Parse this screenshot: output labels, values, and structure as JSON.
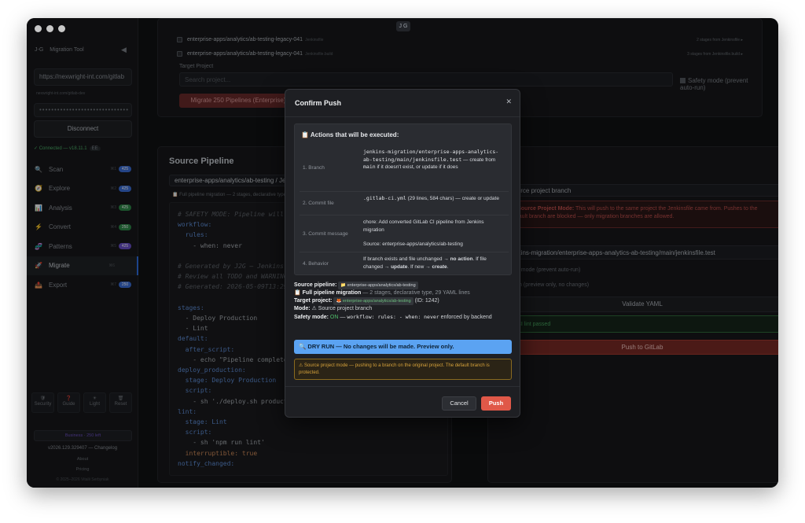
{
  "window": {
    "logo": "J G"
  },
  "sidebar": {
    "brand": "J-G",
    "title": "Migration Tool",
    "url": "https://nexwright-int.com/gitlab",
    "url_sub": "nexwright-int.com/gitlab-dev",
    "token": "••••••••••••••••••••••••••••••",
    "disconnect": "Disconnect",
    "status": "✓ Connected — v18.11.1",
    "status_pill": "EE",
    "items": [
      {
        "label": "Scan",
        "icon": "🔍",
        "kbd": "⌘1",
        "count": "425"
      },
      {
        "label": "Explore",
        "icon": "🧭",
        "kbd": "⌘2",
        "count": "425"
      },
      {
        "label": "Analysis",
        "icon": "📊",
        "kbd": "⌘3",
        "count": "425"
      },
      {
        "label": "Convert",
        "icon": "⚡",
        "kbd": "⌘4",
        "count": "250"
      },
      {
        "label": "Patterns",
        "icon": "🧬",
        "kbd": "⌘5",
        "count": "425"
      },
      {
        "label": "Migrate",
        "icon": "🚀",
        "kbd": "⌘6",
        "count": ""
      },
      {
        "label": "Export",
        "icon": "📤",
        "kbd": "⌘7",
        "count": "250"
      }
    ],
    "tools": [
      {
        "label": "Security",
        "icon": "🛡"
      },
      {
        "label": "Guide",
        "icon": "❓"
      },
      {
        "label": "Light",
        "icon": "☀"
      },
      {
        "label": "Reset",
        "icon": "🗑"
      }
    ],
    "tier": "Business · 250 left",
    "version": "v2026.129.329407 — Changelog",
    "about": "About",
    "pricing": "Pricing",
    "copyright": "© 2025–2026 Vitalii Serbyniak"
  },
  "pipelines": [
    {
      "name": "enterprise-apps/analytics/ab-testing-legacy-041",
      "tag": "Jenkinsfile",
      "right": "2 stages  from Jenkinsfile  ▸"
    },
    {
      "name": "enterprise-apps/analytics/ab-testing-legacy-041",
      "tag": "Jenkinsfile.build",
      "right": "3 stages  from Jenkinsfile.build  ▸"
    }
  ],
  "target_project": {
    "label": "Target Project",
    "placeholder": "Search project...",
    "safety": "Safety mode (prevent auto-run)",
    "migrate_button": "Migrate 250 Pipelines (Enterprise)"
  },
  "source": {
    "title": "Source Pipeline",
    "select": "enterprise-apps/analytics/ab-testing / Jenkinsfile",
    "info": "📋 Full pipeline migration — 2 stages, declarative type",
    "code": [
      {
        "t": "# SAFETY MODE: Pipeline will NOT auto-run",
        "c": "c-comment"
      },
      {
        "t": "workflow:",
        "c": "c-key"
      },
      {
        "t": "  rules:",
        "c": "c-key"
      },
      {
        "t": "    - when: never",
        "c": "c-val"
      },
      {
        "t": "",
        "c": "c-val"
      },
      {
        "t": "# Generated by J2G — Jenkins to GitLab",
        "c": "c-comment"
      },
      {
        "t": "# Review all TODO and WARNING comments",
        "c": "c-comment"
      },
      {
        "t": "# Generated: 2026-05-09T13:29:20",
        "c": "c-comment"
      },
      {
        "t": "",
        "c": "c-val"
      },
      {
        "t": "stages:",
        "c": "c-key"
      },
      {
        "t": "  - Deploy Production",
        "c": "c-val"
      },
      {
        "t": "  - Lint",
        "c": "c-val"
      },
      {
        "t": "default:",
        "c": "c-key"
      },
      {
        "t": "  after_script:",
        "c": "c-key"
      },
      {
        "t": "    - echo \"Pipeline completed.\"",
        "c": "c-val"
      },
      {
        "t": "deploy_production:",
        "c": "c-key"
      },
      {
        "t": "  stage: Deploy Production",
        "c": "c-key"
      },
      {
        "t": "  script:",
        "c": "c-key"
      },
      {
        "t": "    - sh './deploy.sh production'",
        "c": "c-val"
      },
      {
        "t": "lint:",
        "c": "c-key"
      },
      {
        "t": "  stage: Lint",
        "c": "c-key"
      },
      {
        "t": "  script:",
        "c": "c-key"
      },
      {
        "t": "    - sh 'npm run lint'",
        "c": "c-val"
      },
      {
        "t": "  interruptible: true",
        "c": "c-bool"
      },
      {
        "t": "notify_changed:",
        "c": "c-key"
      }
    ]
  },
  "target": {
    "branch_select": "Source project branch",
    "warning_label": "⚠ Source Project Mode:",
    "warning": "This will push to the same project the Jenkinsfile came from. Pushes to the default branch are blocked — only migration branches are allowed.",
    "path": "jenkins-migration/enterprise-apps-analytics-ab-testing/main/jenkinsfile.test",
    "opt1": "Safety mode (prevent auto-run)",
    "opt2": "Dry run (preview only, no changes)",
    "validate": "Validate YAML",
    "lint": "✓ CI lint passed",
    "push": "Push to GitLab"
  },
  "modal": {
    "title": "Confirm Push",
    "close": "✕",
    "actions_title": "📋 Actions that will be executed:",
    "step1_label": "1. Branch",
    "step1_code": "jenkins-migration/enterprise-apps-analytics-ab-testing/main/jenkinsfile.test",
    "step1_text": " — create from ",
    "step1_main": "main",
    "step1_tail": " if it doesn't exist, or update if it does",
    "step2_label": "2. Commit file",
    "step2_code": ".gitlab-ci.yml",
    "step2_text": " (29 lines, 584 chars) — create or update",
    "step3_label": "3. Commit message",
    "step3_msg": "chore: Add converted GitLab CI pipeline from Jenkins migration",
    "step3_source": "Source: enterprise-apps/analytics/ab-testing",
    "step4_label": "4. Behavior",
    "step4_a": "If branch exists and file unchanged → ",
    "step4_b": "no action",
    "step4_c": ". If file changed → ",
    "step4_d": "update",
    "step4_e": ". If new → ",
    "step4_f": "create",
    "step4_g": ".",
    "source_label": "Source pipeline:",
    "source_chip": "📁 enterprise-apps/analytics/ab-testing",
    "full_label": "📋 Full pipeline migration",
    "full_text": " — 2 stages, declarative type, 29 YAML lines",
    "target_label": "Target project:",
    "target_chip": "🦊 enterprise-apps/analytics/ab-testing",
    "target_id": " (ID: 1242)",
    "mode_label": "Mode:",
    "mode_text": " ⚠ Source project branch",
    "safety_label": "Safety mode:",
    "safety_on": " ON",
    "safety_dash": " — ",
    "safety_code": "workflow: rules: - when: never",
    "safety_tail": " enforced by backend",
    "dry_run": "🔍 DRY RUN — No changes will be made. Preview only.",
    "warning": "⚠ Source project mode — pushing to a branch on the original project. The default branch is protected.",
    "cancel": "Cancel",
    "push": "Push"
  }
}
